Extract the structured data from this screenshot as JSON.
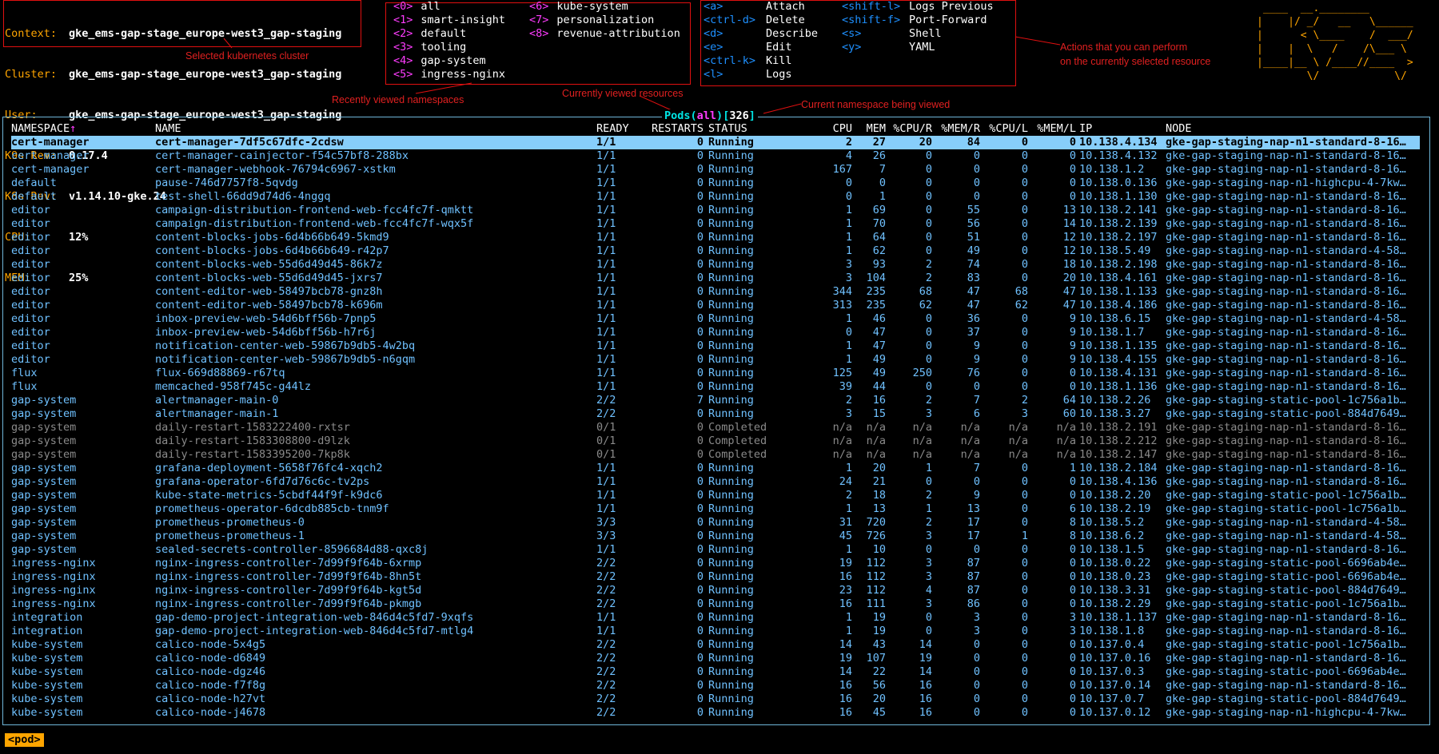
{
  "cluster_info": {
    "context_label": "Context:",
    "context": "gke_ems-gap-stage_europe-west3_gap-staging",
    "cluster_label": "Cluster:",
    "cluster": "gke_ems-gap-stage_europe-west3_gap-staging",
    "user_label": "User:",
    "user": "gke_ems-gap-stage_europe-west3_gap-staging",
    "k9s_rev_label": "K9s Rev:",
    "k9s_rev": "0.17.4",
    "k8s_rev_label": "K8s Rev:",
    "k8s_rev": "v1.14.10-gke.24",
    "cpu_label": "CPU:",
    "cpu": "12%",
    "mem_label": "MEM:",
    "mem": "25%"
  },
  "namespaces": [
    {
      "key": "<0>",
      "name": "all"
    },
    {
      "key": "<1>",
      "name": "smart-insight"
    },
    {
      "key": "<2>",
      "name": "default"
    },
    {
      "key": "<3>",
      "name": "tooling"
    },
    {
      "key": "<4>",
      "name": "gap-system"
    },
    {
      "key": "<5>",
      "name": "ingress-nginx"
    },
    {
      "key": "<6>",
      "name": "kube-system"
    },
    {
      "key": "<7>",
      "name": "personalization"
    },
    {
      "key": "<8>",
      "name": "revenue-attribution"
    }
  ],
  "actions": [
    {
      "key": "<a>",
      "label": "Attach"
    },
    {
      "key": "<ctrl-d>",
      "label": "Delete"
    },
    {
      "key": "<d>",
      "label": "Describe"
    },
    {
      "key": "<e>",
      "label": "Edit"
    },
    {
      "key": "<ctrl-k>",
      "label": "Kill"
    },
    {
      "key": "<l>",
      "label": "Logs"
    },
    {
      "key": "<shift-l>",
      "label": "Logs Previous"
    },
    {
      "key": "<shift-f>",
      "label": "Port-Forward"
    },
    {
      "key": "<s>",
      "label": "Shell"
    },
    {
      "key": "<y>",
      "label": "YAML"
    }
  ],
  "annotations": {
    "cluster": "Selected kubernetes cluster",
    "namespaces": "Recently viewed namespaces",
    "resources": "Currently viewed resources",
    "current_ns": "Current namespace being viewed",
    "actions_line1": "Actions that you can perform",
    "actions_line2": "on the currently selected resource"
  },
  "logo_text": " ____  __.________       \n|    |/ _/   __   \\______\n|      < \\____    /  ___/\n|    |  \\   /    /\\___ \\ \n|____|__ \\ /____//____  >\n        \\/            \\/ ",
  "frame_title": {
    "resource": "Pods",
    "ns": "all",
    "count": "326",
    "open_paren": "(",
    "close_paren": ")",
    "open_brk": "[",
    "close_brk": "]"
  },
  "columns": {
    "namespace": "NAMESPACE",
    "sort_marker": "↑",
    "name": "NAME",
    "ready": "READY",
    "restarts": "RESTARTS",
    "status": "STATUS",
    "cpu": "CPU",
    "mem": "MEM",
    "cpu_r": "%CPU/R",
    "mem_r": "%MEM/R",
    "cpu_l": "%CPU/L",
    "mem_l": "%MEM/L",
    "ip": "IP",
    "node": "NODE"
  },
  "rows": [
    [
      "cert-manager",
      "cert-manager-7df5c67dfc-2cdsw",
      "1/1",
      "0",
      "Running",
      "2",
      "27",
      "20",
      "84",
      "0",
      "0",
      "10.138.4.134",
      "gke-gap-staging-nap-n1-standard-8-16…"
    ],
    [
      "cert-manager",
      "cert-manager-cainjector-f54c57bf8-288bx",
      "1/1",
      "0",
      "Running",
      "4",
      "26",
      "0",
      "0",
      "0",
      "0",
      "10.138.4.132",
      "gke-gap-staging-nap-n1-standard-8-16…"
    ],
    [
      "cert-manager",
      "cert-manager-webhook-76794c6967-xstkm",
      "1/1",
      "0",
      "Running",
      "167",
      "7",
      "0",
      "0",
      "0",
      "0",
      "10.138.1.2",
      "gke-gap-staging-nap-n1-standard-8-16…"
    ],
    [
      "default",
      "pause-746d7757f8-5qvdg",
      "1/1",
      "0",
      "Running",
      "0",
      "0",
      "0",
      "0",
      "0",
      "0",
      "10.138.0.136",
      "gke-gap-staging-nap-n1-highcpu-4-7kw…"
    ],
    [
      "default",
      "test-shell-66dd9d74d6-4nggq",
      "1/1",
      "0",
      "Running",
      "0",
      "1",
      "0",
      "0",
      "0",
      "0",
      "10.138.1.130",
      "gke-gap-staging-nap-n1-standard-8-16…"
    ],
    [
      "editor",
      "campaign-distribution-frontend-web-fcc4fc7f-qmktt",
      "1/1",
      "0",
      "Running",
      "1",
      "69",
      "0",
      "55",
      "0",
      "13",
      "10.138.2.141",
      "gke-gap-staging-nap-n1-standard-8-16…"
    ],
    [
      "editor",
      "campaign-distribution-frontend-web-fcc4fc7f-wqx5f",
      "1/1",
      "0",
      "Running",
      "1",
      "70",
      "0",
      "56",
      "0",
      "14",
      "10.138.2.139",
      "gke-gap-staging-nap-n1-standard-8-16…"
    ],
    [
      "editor",
      "content-blocks-jobs-6d4b66b649-5kmd9",
      "1/1",
      "0",
      "Running",
      "1",
      "64",
      "0",
      "51",
      "0",
      "12",
      "10.138.2.197",
      "gke-gap-staging-nap-n1-standard-8-16…"
    ],
    [
      "editor",
      "content-blocks-jobs-6d4b66b649-r42p7",
      "1/1",
      "0",
      "Running",
      "1",
      "62",
      "0",
      "49",
      "0",
      "12",
      "10.138.5.49",
      "gke-gap-staging-nap-n1-standard-4-58…"
    ],
    [
      "editor",
      "content-blocks-web-55d6d49d45-86k7z",
      "1/1",
      "0",
      "Running",
      "3",
      "93",
      "2",
      "74",
      "0",
      "18",
      "10.138.2.198",
      "gke-gap-staging-nap-n1-standard-8-16…"
    ],
    [
      "editor",
      "content-blocks-web-55d6d49d45-jxrs7",
      "1/1",
      "0",
      "Running",
      "3",
      "104",
      "2",
      "83",
      "0",
      "20",
      "10.138.4.161",
      "gke-gap-staging-nap-n1-standard-8-16…"
    ],
    [
      "editor",
      "content-editor-web-58497bcb78-gnz8h",
      "1/1",
      "0",
      "Running",
      "344",
      "235",
      "68",
      "47",
      "68",
      "47",
      "10.138.1.133",
      "gke-gap-staging-nap-n1-standard-8-16…"
    ],
    [
      "editor",
      "content-editor-web-58497bcb78-k696m",
      "1/1",
      "0",
      "Running",
      "313",
      "235",
      "62",
      "47",
      "62",
      "47",
      "10.138.4.186",
      "gke-gap-staging-nap-n1-standard-8-16…"
    ],
    [
      "editor",
      "inbox-preview-web-54d6bff56b-7pnp5",
      "1/1",
      "0",
      "Running",
      "1",
      "46",
      "0",
      "36",
      "0",
      "9",
      "10.138.6.15",
      "gke-gap-staging-nap-n1-standard-4-58…"
    ],
    [
      "editor",
      "inbox-preview-web-54d6bff56b-h7r6j",
      "1/1",
      "0",
      "Running",
      "0",
      "47",
      "0",
      "37",
      "0",
      "9",
      "10.138.1.7",
      "gke-gap-staging-nap-n1-standard-8-16…"
    ],
    [
      "editor",
      "notification-center-web-59867b9db5-4w2bq",
      "1/1",
      "0",
      "Running",
      "1",
      "47",
      "0",
      "9",
      "0",
      "9",
      "10.138.1.135",
      "gke-gap-staging-nap-n1-standard-8-16…"
    ],
    [
      "editor",
      "notification-center-web-59867b9db5-n6gqm",
      "1/1",
      "0",
      "Running",
      "1",
      "49",
      "0",
      "9",
      "0",
      "9",
      "10.138.4.155",
      "gke-gap-staging-nap-n1-standard-8-16…"
    ],
    [
      "flux",
      "flux-669d88869-r67tq",
      "1/1",
      "0",
      "Running",
      "125",
      "49",
      "250",
      "76",
      "0",
      "0",
      "10.138.4.131",
      "gke-gap-staging-nap-n1-standard-8-16…"
    ],
    [
      "flux",
      "memcached-958f745c-g44lz",
      "1/1",
      "0",
      "Running",
      "39",
      "44",
      "0",
      "0",
      "0",
      "0",
      "10.138.1.136",
      "gke-gap-staging-nap-n1-standard-8-16…"
    ],
    [
      "gap-system",
      "alertmanager-main-0",
      "2/2",
      "7",
      "Running",
      "2",
      "16",
      "2",
      "7",
      "2",
      "64",
      "10.138.2.26",
      "gke-gap-staging-static-pool-1c756a1b…"
    ],
    [
      "gap-system",
      "alertmanager-main-1",
      "2/2",
      "0",
      "Running",
      "3",
      "15",
      "3",
      "6",
      "3",
      "60",
      "10.138.3.27",
      "gke-gap-staging-static-pool-884d7649…"
    ],
    [
      "gap-system",
      "daily-restart-1583222400-rxtsr",
      "0/1",
      "0",
      "Completed",
      "n/a",
      "n/a",
      "n/a",
      "n/a",
      "n/a",
      "n/a",
      "10.138.2.191",
      "gke-gap-staging-nap-n1-standard-8-16…"
    ],
    [
      "gap-system",
      "daily-restart-1583308800-d9lzk",
      "0/1",
      "0",
      "Completed",
      "n/a",
      "n/a",
      "n/a",
      "n/a",
      "n/a",
      "n/a",
      "10.138.2.212",
      "gke-gap-staging-nap-n1-standard-8-16…"
    ],
    [
      "gap-system",
      "daily-restart-1583395200-7kp8k",
      "0/1",
      "0",
      "Completed",
      "n/a",
      "n/a",
      "n/a",
      "n/a",
      "n/a",
      "n/a",
      "10.138.2.147",
      "gke-gap-staging-nap-n1-standard-8-16…"
    ],
    [
      "gap-system",
      "grafana-deployment-5658f76fc4-xqch2",
      "1/1",
      "0",
      "Running",
      "1",
      "20",
      "1",
      "7",
      "0",
      "1",
      "10.138.2.184",
      "gke-gap-staging-nap-n1-standard-8-16…"
    ],
    [
      "gap-system",
      "grafana-operator-6fd7d76c6c-tv2ps",
      "1/1",
      "0",
      "Running",
      "24",
      "21",
      "0",
      "0",
      "0",
      "0",
      "10.138.4.136",
      "gke-gap-staging-nap-n1-standard-8-16…"
    ],
    [
      "gap-system",
      "kube-state-metrics-5cbdf44f9f-k9dc6",
      "1/1",
      "0",
      "Running",
      "2",
      "18",
      "2",
      "9",
      "0",
      "0",
      "10.138.2.20",
      "gke-gap-staging-static-pool-1c756a1b…"
    ],
    [
      "gap-system",
      "prometheus-operator-6dcdb885cb-tnm9f",
      "1/1",
      "0",
      "Running",
      "1",
      "13",
      "1",
      "13",
      "0",
      "6",
      "10.138.2.19",
      "gke-gap-staging-static-pool-1c756a1b…"
    ],
    [
      "gap-system",
      "prometheus-prometheus-0",
      "3/3",
      "0",
      "Running",
      "31",
      "720",
      "2",
      "17",
      "0",
      "8",
      "10.138.5.2",
      "gke-gap-staging-nap-n1-standard-4-58…"
    ],
    [
      "gap-system",
      "prometheus-prometheus-1",
      "3/3",
      "0",
      "Running",
      "45",
      "726",
      "3",
      "17",
      "1",
      "8",
      "10.138.6.2",
      "gke-gap-staging-nap-n1-standard-4-58…"
    ],
    [
      "gap-system",
      "sealed-secrets-controller-8596684d88-qxc8j",
      "1/1",
      "0",
      "Running",
      "1",
      "10",
      "0",
      "0",
      "0",
      "0",
      "10.138.1.5",
      "gke-gap-staging-nap-n1-standard-8-16…"
    ],
    [
      "ingress-nginx",
      "nginx-ingress-controller-7d99f9f64b-6xrmp",
      "2/2",
      "0",
      "Running",
      "19",
      "112",
      "3",
      "87",
      "0",
      "0",
      "10.138.0.22",
      "gke-gap-staging-static-pool-6696ab4e…"
    ],
    [
      "ingress-nginx",
      "nginx-ingress-controller-7d99f9f64b-8hn5t",
      "2/2",
      "0",
      "Running",
      "16",
      "112",
      "3",
      "87",
      "0",
      "0",
      "10.138.0.23",
      "gke-gap-staging-static-pool-6696ab4e…"
    ],
    [
      "ingress-nginx",
      "nginx-ingress-controller-7d99f9f64b-kgt5d",
      "2/2",
      "0",
      "Running",
      "23",
      "112",
      "4",
      "87",
      "0",
      "0",
      "10.138.3.31",
      "gke-gap-staging-static-pool-884d7649…"
    ],
    [
      "ingress-nginx",
      "nginx-ingress-controller-7d99f9f64b-pkmgb",
      "2/2",
      "0",
      "Running",
      "16",
      "111",
      "3",
      "86",
      "0",
      "0",
      "10.138.2.29",
      "gke-gap-staging-static-pool-1c756a1b…"
    ],
    [
      "integration",
      "gap-demo-project-integration-web-846d4c5fd7-9xqfs",
      "1/1",
      "0",
      "Running",
      "1",
      "19",
      "0",
      "3",
      "0",
      "3",
      "10.138.1.137",
      "gke-gap-staging-nap-n1-standard-8-16…"
    ],
    [
      "integration",
      "gap-demo-project-integration-web-846d4c5fd7-mtlg4",
      "1/1",
      "0",
      "Running",
      "1",
      "19",
      "0",
      "3",
      "0",
      "3",
      "10.138.1.8",
      "gke-gap-staging-nap-n1-standard-8-16…"
    ],
    [
      "kube-system",
      "calico-node-5x4g5",
      "2/2",
      "0",
      "Running",
      "14",
      "43",
      "14",
      "0",
      "0",
      "0",
      "10.137.0.4",
      "gke-gap-staging-static-pool-1c756a1b…"
    ],
    [
      "kube-system",
      "calico-node-d6849",
      "2/2",
      "0",
      "Running",
      "19",
      "107",
      "19",
      "0",
      "0",
      "0",
      "10.137.0.16",
      "gke-gap-staging-nap-n1-standard-8-16…"
    ],
    [
      "kube-system",
      "calico-node-dgz46",
      "2/2",
      "0",
      "Running",
      "14",
      "22",
      "14",
      "0",
      "0",
      "0",
      "10.137.0.3",
      "gke-gap-staging-static-pool-6696ab4e…"
    ],
    [
      "kube-system",
      "calico-node-f7f8g",
      "2/2",
      "0",
      "Running",
      "16",
      "56",
      "16",
      "0",
      "0",
      "0",
      "10.137.0.14",
      "gke-gap-staging-nap-n1-standard-8-16…"
    ],
    [
      "kube-system",
      "calico-node-h27vt",
      "2/2",
      "0",
      "Running",
      "16",
      "20",
      "16",
      "0",
      "0",
      "0",
      "10.137.0.7",
      "gke-gap-staging-static-pool-884d7649…"
    ],
    [
      "kube-system",
      "calico-node-j4678",
      "2/2",
      "0",
      "Running",
      "16",
      "45",
      "16",
      "0",
      "0",
      "0",
      "10.137.0.12",
      "gke-gap-staging-nap-n1-highcpu-4-7kw…"
    ]
  ],
  "selected_row": 0,
  "breadcrumb": "<pod>",
  "colors": {
    "accent_orange": "#ffa500",
    "namespace_key": "#ff3cff",
    "action_key": "#1e90ff",
    "row_running": "#6fc1ff",
    "row_completed": "#8a8a8a",
    "selected_bg": "#87cefa",
    "frame_border": "#6fb6d9",
    "annotation_red": "#e02020"
  }
}
